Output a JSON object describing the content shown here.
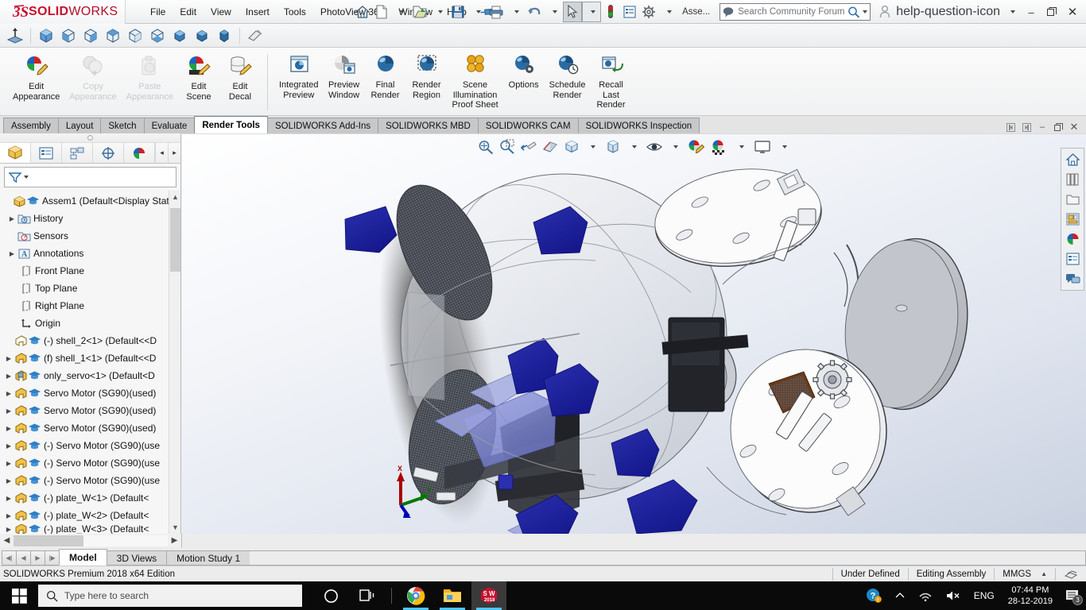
{
  "app": {
    "brand_ds": "ĩ2S",
    "brand_solid": "SOLID",
    "brand_works": "WORKS",
    "status_edition": "SOLIDWORKS Premium 2018 x64 Edition"
  },
  "menu": {
    "items": [
      {
        "label": "File"
      },
      {
        "label": "Edit"
      },
      {
        "label": "View"
      },
      {
        "label": "Insert"
      },
      {
        "label": "Tools"
      },
      {
        "label": "PhotoView 360"
      },
      {
        "label": "Window"
      },
      {
        "label": "Help"
      }
    ],
    "pin_icon": "pushpin-icon"
  },
  "title_tools": {
    "home_icon": "home-icon",
    "new_icon": "new-document-icon",
    "open_icon": "open-folder-icon",
    "save_icon": "save-icon",
    "print_icon": "print-icon",
    "undo_icon": "undo-icon",
    "select_icon": "select-arrow-icon",
    "rebuild_icon": "rebuild-traffic-light-icon",
    "display_icon": "display-options-icon",
    "options_icon": "gear-options-icon",
    "assembly_label": "Asse...",
    "search": {
      "placeholder": "Search Community Forum",
      "icon": "search-magnifier-icon",
      "chat_icon": "community-chat-icon"
    },
    "user_icon": "user-account-icon",
    "help_icon": "help-question-icon",
    "minimize": "–",
    "restore": "❐",
    "close": "✕"
  },
  "orientation_toolbar": {
    "items": [
      {
        "name": "normal-to-icon"
      },
      {
        "name": "isometric-view-icon"
      },
      {
        "name": "front-view-icon"
      },
      {
        "name": "left-view-icon"
      },
      {
        "name": "right-view-icon"
      },
      {
        "name": "back-view-icon"
      },
      {
        "name": "bottom-view-icon"
      },
      {
        "name": "trimetric-view-icon"
      },
      {
        "name": "dimetric-view-icon"
      },
      {
        "name": "top-view-icon"
      },
      {
        "name": "section-view-icon"
      }
    ]
  },
  "ribbon": {
    "groups": [
      {
        "commands": [
          {
            "label": "Edit\nAppearance",
            "icon": "edit-appearance-icon",
            "disabled": false
          },
          {
            "label": "Copy\nAppearance",
            "icon": "copy-appearance-icon",
            "disabled": true
          },
          {
            "label": "Paste\nAppearance",
            "icon": "paste-appearance-icon",
            "disabled": true
          },
          {
            "label": "Edit\nScene",
            "icon": "edit-scene-icon",
            "disabled": false
          },
          {
            "label": "Edit\nDecal",
            "icon": "edit-decal-icon",
            "disabled": false
          }
        ]
      },
      {
        "commands": [
          {
            "label": "Integrated\nPreview",
            "icon": "integrated-preview-icon",
            "disabled": false
          },
          {
            "label": "Preview\nWindow",
            "icon": "preview-window-icon",
            "disabled": false
          },
          {
            "label": "Final\nRender",
            "icon": "final-render-icon",
            "disabled": false
          },
          {
            "label": "Render\nRegion",
            "icon": "render-region-icon",
            "disabled": false
          },
          {
            "label": "Scene\nIllumination\nProof Sheet",
            "icon": "scene-illumination-icon",
            "disabled": false
          },
          {
            "label": "Options",
            "icon": "render-options-icon",
            "disabled": false
          },
          {
            "label": "Schedule\nRender",
            "icon": "schedule-render-icon",
            "disabled": false
          },
          {
            "label": "Recall\nLast\nRender",
            "icon": "recall-last-render-icon",
            "disabled": false
          }
        ]
      }
    ]
  },
  "command_tabs": {
    "tabs": [
      {
        "label": "Assembly",
        "active": false
      },
      {
        "label": "Layout",
        "active": false
      },
      {
        "label": "Sketch",
        "active": false
      },
      {
        "label": "Evaluate",
        "active": false
      },
      {
        "label": "Render Tools",
        "active": true
      },
      {
        "label": "SOLIDWORKS Add-Ins",
        "active": false
      },
      {
        "label": "SOLIDWORKS MBD",
        "active": false
      },
      {
        "label": "SOLIDWORKS CAM",
        "active": false
      },
      {
        "label": "SOLIDWORKS Inspection",
        "active": false
      }
    ],
    "window_controls": [
      "◀",
      "▶",
      "–",
      "❐",
      "✕"
    ]
  },
  "feature_manager": {
    "tabs": [
      {
        "name": "feature-tree-tab",
        "active": true
      },
      {
        "name": "property-manager-tab",
        "active": false
      },
      {
        "name": "configuration-manager-tab",
        "active": false
      },
      {
        "name": "dimxpert-manager-tab",
        "active": false
      },
      {
        "name": "display-manager-tab",
        "active": false
      }
    ],
    "arrow_left": "◂",
    "arrow_right": "▸",
    "filter_icon": "filter-funnel-icon",
    "tree": [
      {
        "label": "Assem1  (Default<Display Stat",
        "indent": 0,
        "arrow": false,
        "icons": [
          "assembly-icon",
          "graduation-cap-icon"
        ]
      },
      {
        "label": "History",
        "indent": 1,
        "arrow": true,
        "icons": [
          "history-folder-icon"
        ]
      },
      {
        "label": "Sensors",
        "indent": 1,
        "arrow": false,
        "icons": [
          "sensors-folder-icon"
        ]
      },
      {
        "label": "Annotations",
        "indent": 1,
        "arrow": true,
        "icons": [
          "annotations-icon"
        ]
      },
      {
        "label": "Front Plane",
        "indent": 1,
        "arrow": false,
        "icons": [
          "plane-icon"
        ]
      },
      {
        "label": "Top Plane",
        "indent": 1,
        "arrow": false,
        "icons": [
          "plane-icon"
        ]
      },
      {
        "label": "Right Plane",
        "indent": 1,
        "arrow": false,
        "icons": [
          "plane-icon"
        ]
      },
      {
        "label": "Origin",
        "indent": 1,
        "arrow": false,
        "icons": [
          "origin-icon"
        ]
      },
      {
        "label": "(-) shell_2<1> (Default<<D",
        "indent": 1,
        "arrow": false,
        "icons": [
          "part-transparent-icon",
          "graduation-cap-icon"
        ]
      },
      {
        "label": "(f) shell_1<1> (Default<<D",
        "indent": 1,
        "arrow": true,
        "icons": [
          "part-icon",
          "graduation-cap-icon"
        ]
      },
      {
        "label": "only_servo<1> (Default<D",
        "indent": 1,
        "arrow": true,
        "icons": [
          "subassembly-icon",
          "graduation-cap-icon"
        ]
      },
      {
        "label": "Servo Motor (SG90)(used)",
        "indent": 1,
        "arrow": true,
        "icons": [
          "part-icon",
          "graduation-cap-icon"
        ]
      },
      {
        "label": "Servo Motor (SG90)(used)",
        "indent": 1,
        "arrow": true,
        "icons": [
          "part-icon",
          "graduation-cap-icon"
        ]
      },
      {
        "label": "Servo Motor (SG90)(used)",
        "indent": 1,
        "arrow": true,
        "icons": [
          "part-icon",
          "graduation-cap-icon"
        ]
      },
      {
        "label": "(-) Servo Motor (SG90)(use",
        "indent": 1,
        "arrow": true,
        "icons": [
          "part-icon",
          "graduation-cap-icon"
        ]
      },
      {
        "label": "(-) Servo Motor (SG90)(use",
        "indent": 1,
        "arrow": true,
        "icons": [
          "part-icon",
          "graduation-cap-icon"
        ]
      },
      {
        "label": "(-) Servo Motor (SG90)(use",
        "indent": 1,
        "arrow": true,
        "icons": [
          "part-icon",
          "graduation-cap-icon"
        ]
      },
      {
        "label": "(-) plate_W<1> (Default<",
        "indent": 1,
        "arrow": true,
        "icons": [
          "part-icon",
          "graduation-cap-icon"
        ]
      },
      {
        "label": "(-) plate_W<2> (Default<",
        "indent": 1,
        "arrow": true,
        "icons": [
          "part-icon",
          "graduation-cap-icon"
        ]
      },
      {
        "label": "(-) plate_W<3> (Default<",
        "indent": 1,
        "arrow": true,
        "icons": [
          "part-icon",
          "graduation-cap-icon"
        ]
      }
    ]
  },
  "viewport_toolbar": {
    "items": [
      {
        "name": "zoom-to-fit-icon",
        "caret": false
      },
      {
        "name": "zoom-to-area-icon",
        "caret": false
      },
      {
        "name": "previous-view-icon",
        "caret": false
      },
      {
        "name": "section-view-icon",
        "caret": false
      },
      {
        "name": "view-orientation-icon",
        "caret": true
      },
      {
        "name": "display-style-icon",
        "caret": true
      },
      {
        "name": "hide-show-items-icon",
        "caret": true
      },
      {
        "name": "edit-appearance-icon",
        "caret": false
      },
      {
        "name": "apply-scene-icon",
        "caret": true
      },
      {
        "name": "view-settings-icon",
        "caret": true
      }
    ]
  },
  "right_dock": {
    "items": [
      {
        "name": "view-palette-home-icon"
      },
      {
        "name": "design-library-icon"
      },
      {
        "name": "file-explorer-icon"
      },
      {
        "name": "view-palette-icon"
      },
      {
        "name": "appearances-scenes-icon"
      },
      {
        "name": "custom-properties-icon"
      },
      {
        "name": "solidworks-forum-icon"
      }
    ]
  },
  "triad": {
    "x_label": "X",
    "y_label": "Y",
    "x_color": "#aa0000",
    "y_color": "#007700",
    "z_color": "#0000bb"
  },
  "document_tabs": {
    "nav": [
      "⏮",
      "◀",
      "▶",
      "⏭"
    ],
    "tabs": [
      {
        "label": "Model",
        "active": true
      },
      {
        "label": "3D Views",
        "active": false
      },
      {
        "label": "Motion Study 1",
        "active": false
      }
    ]
  },
  "statusbar": {
    "edition": "SOLIDWORKS Premium 2018 x64 Edition",
    "state": "Under Defined",
    "mode": "Editing Assembly",
    "units": "MMGS",
    "units_caret": "▲",
    "overlay_icon": "overlay-icon"
  },
  "taskbar": {
    "start_icon": "windows-start-icon",
    "search_placeholder": "Type here to search",
    "search_icon": "search-icon",
    "cortana_icon": "cortana-circle-icon",
    "taskview_icon": "task-view-icon",
    "apps": [
      {
        "name": "chrome-icon"
      },
      {
        "name": "file-explorer-icon"
      },
      {
        "name": "solidworks-2018-icon",
        "label": "SW",
        "sublabel": "2018"
      }
    ],
    "tray": {
      "help_icon": "help-notification-icon",
      "chevron_icon": "show-hidden-icons-icon",
      "network_icon": "wifi-icon",
      "volume_icon": "volume-muted-icon",
      "language": "ENG",
      "time": "07:44 PM",
      "date": "28-12-2019",
      "notification_count": "3"
    }
  }
}
